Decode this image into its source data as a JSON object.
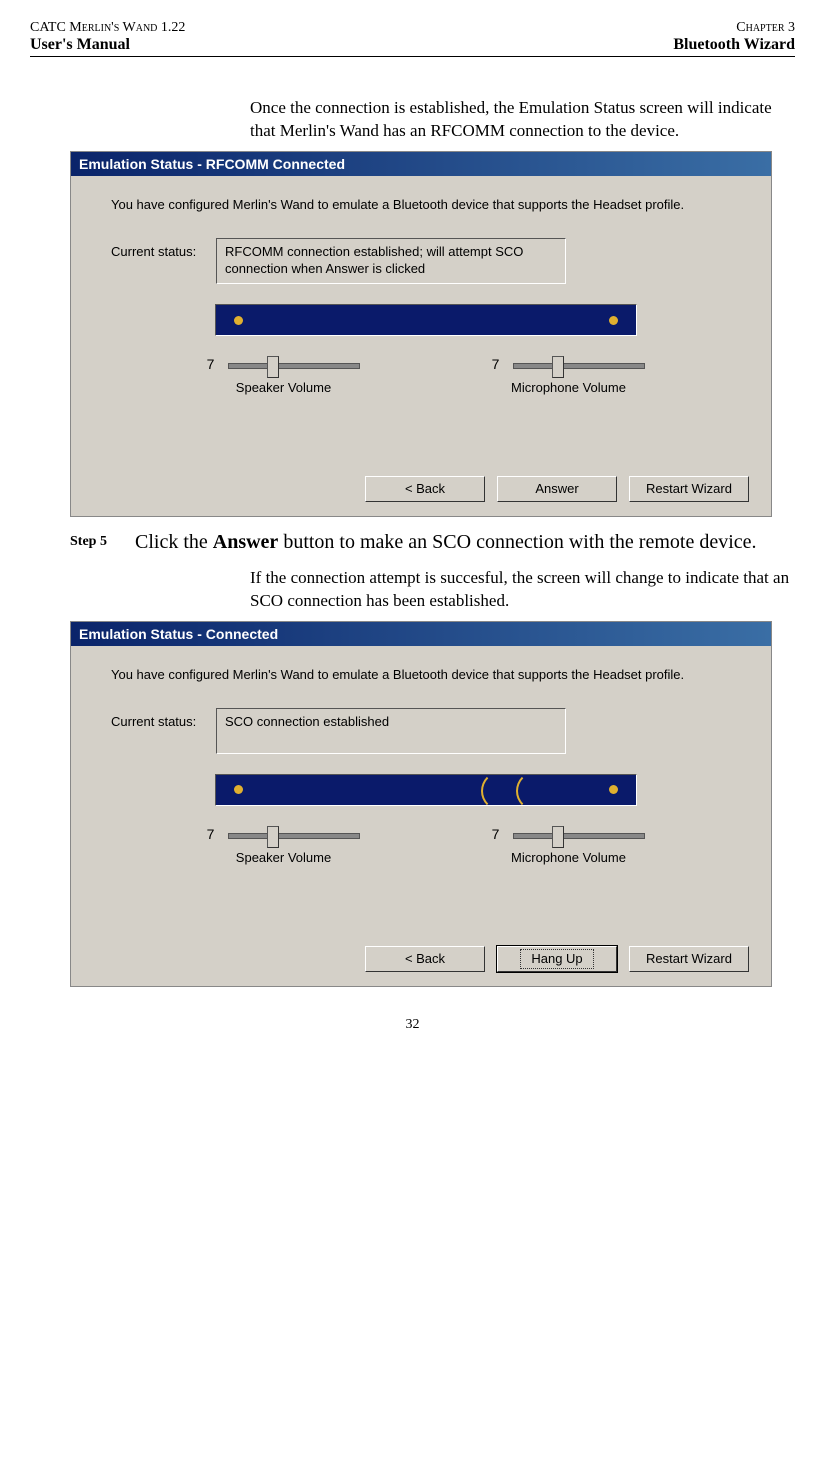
{
  "header": {
    "left_top": "CATC Merlin's Wand 1.22",
    "right_top": "Chapter 3",
    "left_sub": "User's Manual",
    "right_sub": "Bluetooth Wizard"
  },
  "paragraphs": {
    "para1": "Once the connection is established, the Emulation Status screen will indicate that Merlin's Wand has an RFCOMM connection to the device.",
    "para2": "If the connection attempt is succesful, the screen will change to indicate that an SCO connection has been established."
  },
  "step": {
    "label": "Step 5",
    "text_prefix": "Click the ",
    "text_bold": "Answer",
    "text_suffix": " button to make an SCO connection with the remote device."
  },
  "dialog1": {
    "title": "Emulation Status - RFCOMM Connected",
    "intro": "You have configured Merlin's Wand to emulate a Bluetooth device that supports the Headset profile.",
    "status_label": "Current status:",
    "status_text": "RFCOMM connection established; will attempt SCO connection when Answer is clicked",
    "speaker_value": "7",
    "speaker_label": "Speaker Volume",
    "mic_value": "7",
    "mic_label": "Microphone Volume",
    "btn_back": "< Back",
    "btn_answer": "Answer",
    "btn_restart": "Restart Wizard"
  },
  "dialog2": {
    "title": "Emulation Status - Connected",
    "intro": "You have configured Merlin's Wand to emulate a Bluetooth device that supports the Headset profile.",
    "status_label": "Current status:",
    "status_text": "SCO connection established",
    "speaker_value": "7",
    "speaker_label": "Speaker Volume",
    "mic_value": "7",
    "mic_label": "Microphone Volume",
    "btn_back": "< Back",
    "btn_hangup": "Hang Up",
    "btn_restart": "Restart Wizard"
  },
  "page_number": "32"
}
